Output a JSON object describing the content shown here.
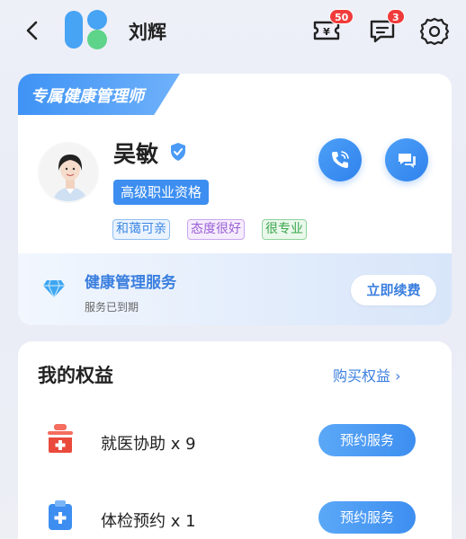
{
  "header": {
    "username": "刘辉",
    "coupon_badge": "50",
    "coupon_icon_text": "¥",
    "message_badge": "3"
  },
  "manager": {
    "section_tag": "专属健康管理师",
    "name": "吴敏",
    "qualification": "高级职业资格",
    "tags": [
      "和蔼可亲",
      "态度很好",
      "很专业"
    ]
  },
  "service": {
    "title": "健康管理服务",
    "status": "服务已到期",
    "renew_label": "立即续费"
  },
  "benefits": {
    "title": "我的权益",
    "buy_label": "购买权益 ›",
    "items": [
      {
        "label": "就医协助 x 9",
        "button": "预约服务"
      },
      {
        "label": "体检预约 x 1",
        "button": "预约服务"
      }
    ]
  },
  "colors": {
    "accent": "#3b7fdf",
    "badge": "#f03b3b",
    "logo_blue": "#47a3f3",
    "logo_green": "#5ed38a"
  }
}
